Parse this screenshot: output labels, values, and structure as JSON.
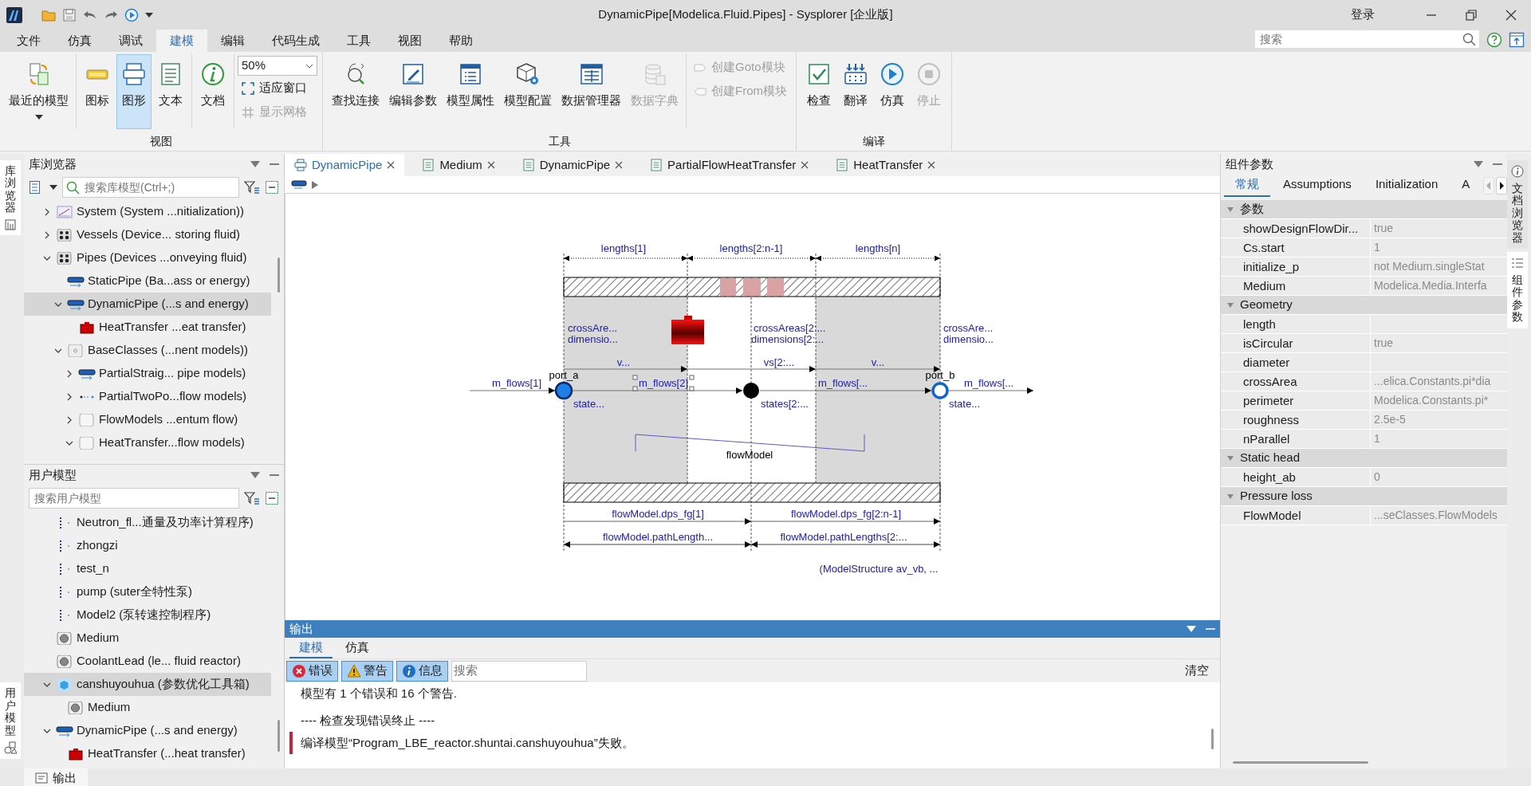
{
  "window": {
    "title": "DynamicPipe[Modelica.Fluid.Pipes] - Sysplorer [企业版]",
    "login": "登录"
  },
  "menu": [
    {
      "label": "文件",
      "selected": false
    },
    {
      "label": "仿真",
      "selected": false
    },
    {
      "label": "调试",
      "selected": false
    },
    {
      "label": "建模",
      "selected": true
    },
    {
      "label": "编辑",
      "selected": false
    },
    {
      "label": "代码生成",
      "selected": false
    },
    {
      "label": "工具",
      "selected": false
    },
    {
      "label": "视图",
      "selected": false
    },
    {
      "label": "帮助",
      "selected": false
    }
  ],
  "search": {
    "placeholder": "搜索"
  },
  "ribbon": {
    "groups": [
      {
        "label": "视图",
        "sections": [
          [
            {
              "kind": "dropdown",
              "label": "最近的模型",
              "selected": false,
              "disabled": false
            }
          ],
          [
            {
              "kind": "large",
              "label": "图标",
              "selected": false,
              "disabled": false
            },
            {
              "kind": "large",
              "label": "图形",
              "selected": true,
              "disabled": false
            },
            {
              "kind": "large",
              "label": "文本",
              "selected": false,
              "disabled": false
            }
          ],
          [
            {
              "kind": "large",
              "label": "文档",
              "selected": false,
              "disabled": false
            }
          ],
          [
            {
              "kind": "combo",
              "value": "50%"
            },
            {
              "kind": "small",
              "label": "适应窗口",
              "selected": false,
              "disabled": false
            },
            {
              "kind": "small",
              "label": "显示网格",
              "selected": false,
              "disabled": true
            }
          ]
        ]
      },
      {
        "label": "工具",
        "sections": [
          [
            {
              "kind": "large",
              "label": "查找连接",
              "selected": false,
              "disabled": false
            },
            {
              "kind": "large",
              "label": "编辑参数",
              "selected": false,
              "disabled": false
            },
            {
              "kind": "large",
              "label": "模型属性",
              "selected": false,
              "disabled": false
            },
            {
              "kind": "large",
              "label": "模型配置",
              "selected": false,
              "disabled": false
            },
            {
              "kind": "large",
              "label": "数据管理器",
              "selected": false,
              "disabled": false
            },
            {
              "kind": "large",
              "label": "数据字典",
              "selected": false,
              "disabled": true
            }
          ],
          [
            {
              "kind": "small",
              "label": "创建Goto模块",
              "selected": false,
              "disabled": true
            },
            {
              "kind": "small",
              "label": "创建From模块",
              "selected": false,
              "disabled": true
            }
          ]
        ]
      },
      {
        "label": "编译",
        "sections": [
          [
            {
              "kind": "large",
              "label": "检查",
              "selected": false,
              "disabled": false
            },
            {
              "kind": "large",
              "label": "翻译",
              "selected": false,
              "disabled": false
            },
            {
              "kind": "large",
              "label": "仿真",
              "selected": false,
              "disabled": false
            },
            {
              "kind": "large",
              "label": "停止",
              "selected": false,
              "disabled": true
            }
          ]
        ]
      }
    ]
  },
  "side_tabs": {
    "left": [
      {
        "label": "库浏览器",
        "selected": true
      },
      {
        "label": "用户模型",
        "selected": true
      }
    ],
    "right": [
      {
        "label": "文档浏览器",
        "selected": false
      },
      {
        "label": "组件参数",
        "selected": true
      }
    ]
  },
  "library": {
    "title": "库浏览器",
    "search": {
      "placeholder": "搜索库模型(Ctrl+;)"
    },
    "tree": [
      {
        "kind": "system",
        "label": "System (System ...nitialization))",
        "expanded": false,
        "selected": false
      },
      {
        "kind": "vessel",
        "label": "Vessels (Device... storing fluid)",
        "expanded": false,
        "selected": false
      },
      {
        "kind": "vessel",
        "label": "Pipes (Devices ...onveying fluid)",
        "expanded": true,
        "selected": false,
        "children": [
          {
            "kind": "pipe",
            "label": "StaticPipe (Ba...ass or energy)",
            "selected": false
          },
          {
            "kind": "pipe",
            "label": "DynamicPipe (...s and energy)",
            "expanded": true,
            "selected": true,
            "children": [
              {
                "kind": "heater",
                "label": "HeatTransfer ...eat transfer)",
                "selected": false
              }
            ]
          },
          {
            "kind": "package",
            "label": "BaseClasses (...nent models))",
            "expanded": true,
            "selected": false,
            "children": [
              {
                "kind": "pipe",
                "label": "PartialStraig... pipe models)",
                "expanded": false,
                "selected": false
              },
              {
                "kind": "twoport",
                "label": "PartialTwoPo...flow models)",
                "expanded": false,
                "selected": false
              },
              {
                "kind": "blank",
                "label": "FlowModels ...entum flow)",
                "expanded": false,
                "selected": false
              },
              {
                "kind": "blank",
                "label": "HeatTransfer...flow models)",
                "expanded": true,
                "selected": false
              }
            ]
          }
        ]
      }
    ]
  },
  "user_models": {
    "title": "用户模型",
    "search": {
      "placeholder": "搜索用户模型"
    },
    "tree": [
      {
        "kind": "dotted",
        "label": "Neutron_fl...通量及功率计算程序)",
        "selected": false
      },
      {
        "kind": "dotted",
        "label": "zhongzi",
        "selected": false
      },
      {
        "kind": "dotted",
        "label": "test_n",
        "selected": false
      },
      {
        "kind": "dotted",
        "label": "pump (suter全特性泵)",
        "selected": false
      },
      {
        "kind": "dotted",
        "label": "Model2 (泵转速控制程序)",
        "selected": false
      },
      {
        "kind": "medium",
        "label": "Medium",
        "selected": false
      },
      {
        "kind": "medium",
        "label": "CoolantLead (le... fluid reactor)",
        "selected": false
      },
      {
        "kind": "cube",
        "label": "canshuyouhua (参数优化工具箱)",
        "expanded": true,
        "selected": true,
        "children": [
          {
            "kind": "medium",
            "label": "Medium",
            "selected": false
          }
        ]
      },
      {
        "kind": "pipe",
        "label": "DynamicPipe (...s and energy)",
        "expanded": true,
        "selected": false,
        "children": [
          {
            "kind": "heater",
            "label": "HeatTransfer (...heat transfer)",
            "selected": false
          }
        ]
      }
    ]
  },
  "doc_tabs": [
    {
      "kind": "diagram",
      "label": "DynamicPipe",
      "selected": true
    },
    {
      "kind": "text",
      "label": "Medium",
      "selected": false
    },
    {
      "kind": "text",
      "label": "DynamicPipe",
      "selected": false
    },
    {
      "kind": "text",
      "label": "PartialFlowHeatTransfer",
      "selected": false
    },
    {
      "kind": "text",
      "label": "HeatTransfer",
      "selected": false
    }
  ],
  "diagram": {
    "labels": [
      "lengths[1]",
      "lengths[2:n-1]",
      "lengths[n]",
      "crossAre...",
      "dimensio...",
      "crossAreas[2:...",
      "dimensions[2:...",
      "crossAre...",
      "dimensio...",
      "v...",
      "vs[2:...",
      "v...",
      "m_flows[1]",
      "port_a",
      "m_flows[2]",
      "m_flows[...",
      "port_b",
      "m_flows[...",
      "state...",
      "states[2:...",
      "state...",
      "flowModel",
      "flowModel.dps_fg[1]",
      "flowModel.dps_fg[2:n-1]",
      "flowModel.pathLength...",
      "flowModel.pathLengths[2:...",
      "(ModelStructure av_vb, ..."
    ]
  },
  "output": {
    "title": "输出",
    "tabs": [
      {
        "label": "建模",
        "selected": true
      },
      {
        "label": "仿真",
        "selected": false
      }
    ],
    "filters": [
      {
        "kind": "error",
        "label": "错误",
        "selected": true
      },
      {
        "kind": "warning",
        "label": "警告",
        "selected": true
      },
      {
        "kind": "info",
        "label": "信息",
        "selected": true
      }
    ],
    "search": {
      "placeholder": "搜索"
    },
    "clear": "清空",
    "messages": [
      {
        "kind": "info",
        "text": "模型有 1 个错误和 16 个警告."
      },
      {
        "kind": "info",
        "text": "---- 检查发现错误终止 ----"
      },
      {
        "kind": "error",
        "text": "编译模型“Program_LBE_reactor.shuntai.canshuyouhua”失败。"
      }
    ]
  },
  "params": {
    "title": "组件参数",
    "tabs": [
      {
        "label": "常规",
        "selected": true
      },
      {
        "label": "Assumptions",
        "selected": false
      },
      {
        "label": "Initialization",
        "selected": false
      },
      {
        "label": "A",
        "selected": false
      }
    ],
    "sections": [
      {
        "title": "参数",
        "expanded": true,
        "rows": [
          {
            "name": "showDesignFlowDir...",
            "value": "true"
          },
          {
            "name": "Cs.start",
            "value": "1"
          },
          {
            "name": "initialize_p",
            "value": "not Medium.singleStat"
          },
          {
            "name": "Medium",
            "value": "Modelica.Media.Interfa"
          }
        ]
      },
      {
        "title": "Geometry",
        "expanded": true,
        "rows": [
          {
            "name": "length"
          },
          {
            "name": "isCircular",
            "value": "true"
          },
          {
            "name": "diameter"
          },
          {
            "name": "crossArea",
            "value": "...elica.Constants.pi*dia"
          },
          {
            "name": "perimeter",
            "value": "Modelica.Constants.pi*"
          },
          {
            "name": "roughness",
            "value": "2.5e-5"
          },
          {
            "name": "nParallel",
            "value": "1"
          }
        ]
      },
      {
        "title": "Static head",
        "expanded": true,
        "rows": [
          {
            "name": "height_ab",
            "value": "0"
          }
        ]
      },
      {
        "title": "Pressure loss",
        "expanded": true,
        "rows": [
          {
            "name": "FlowModel",
            "value": "...seClasses.FlowModels"
          }
        ]
      }
    ]
  },
  "status_bar": {
    "tabs": [
      {
        "label": "输出"
      }
    ]
  }
}
